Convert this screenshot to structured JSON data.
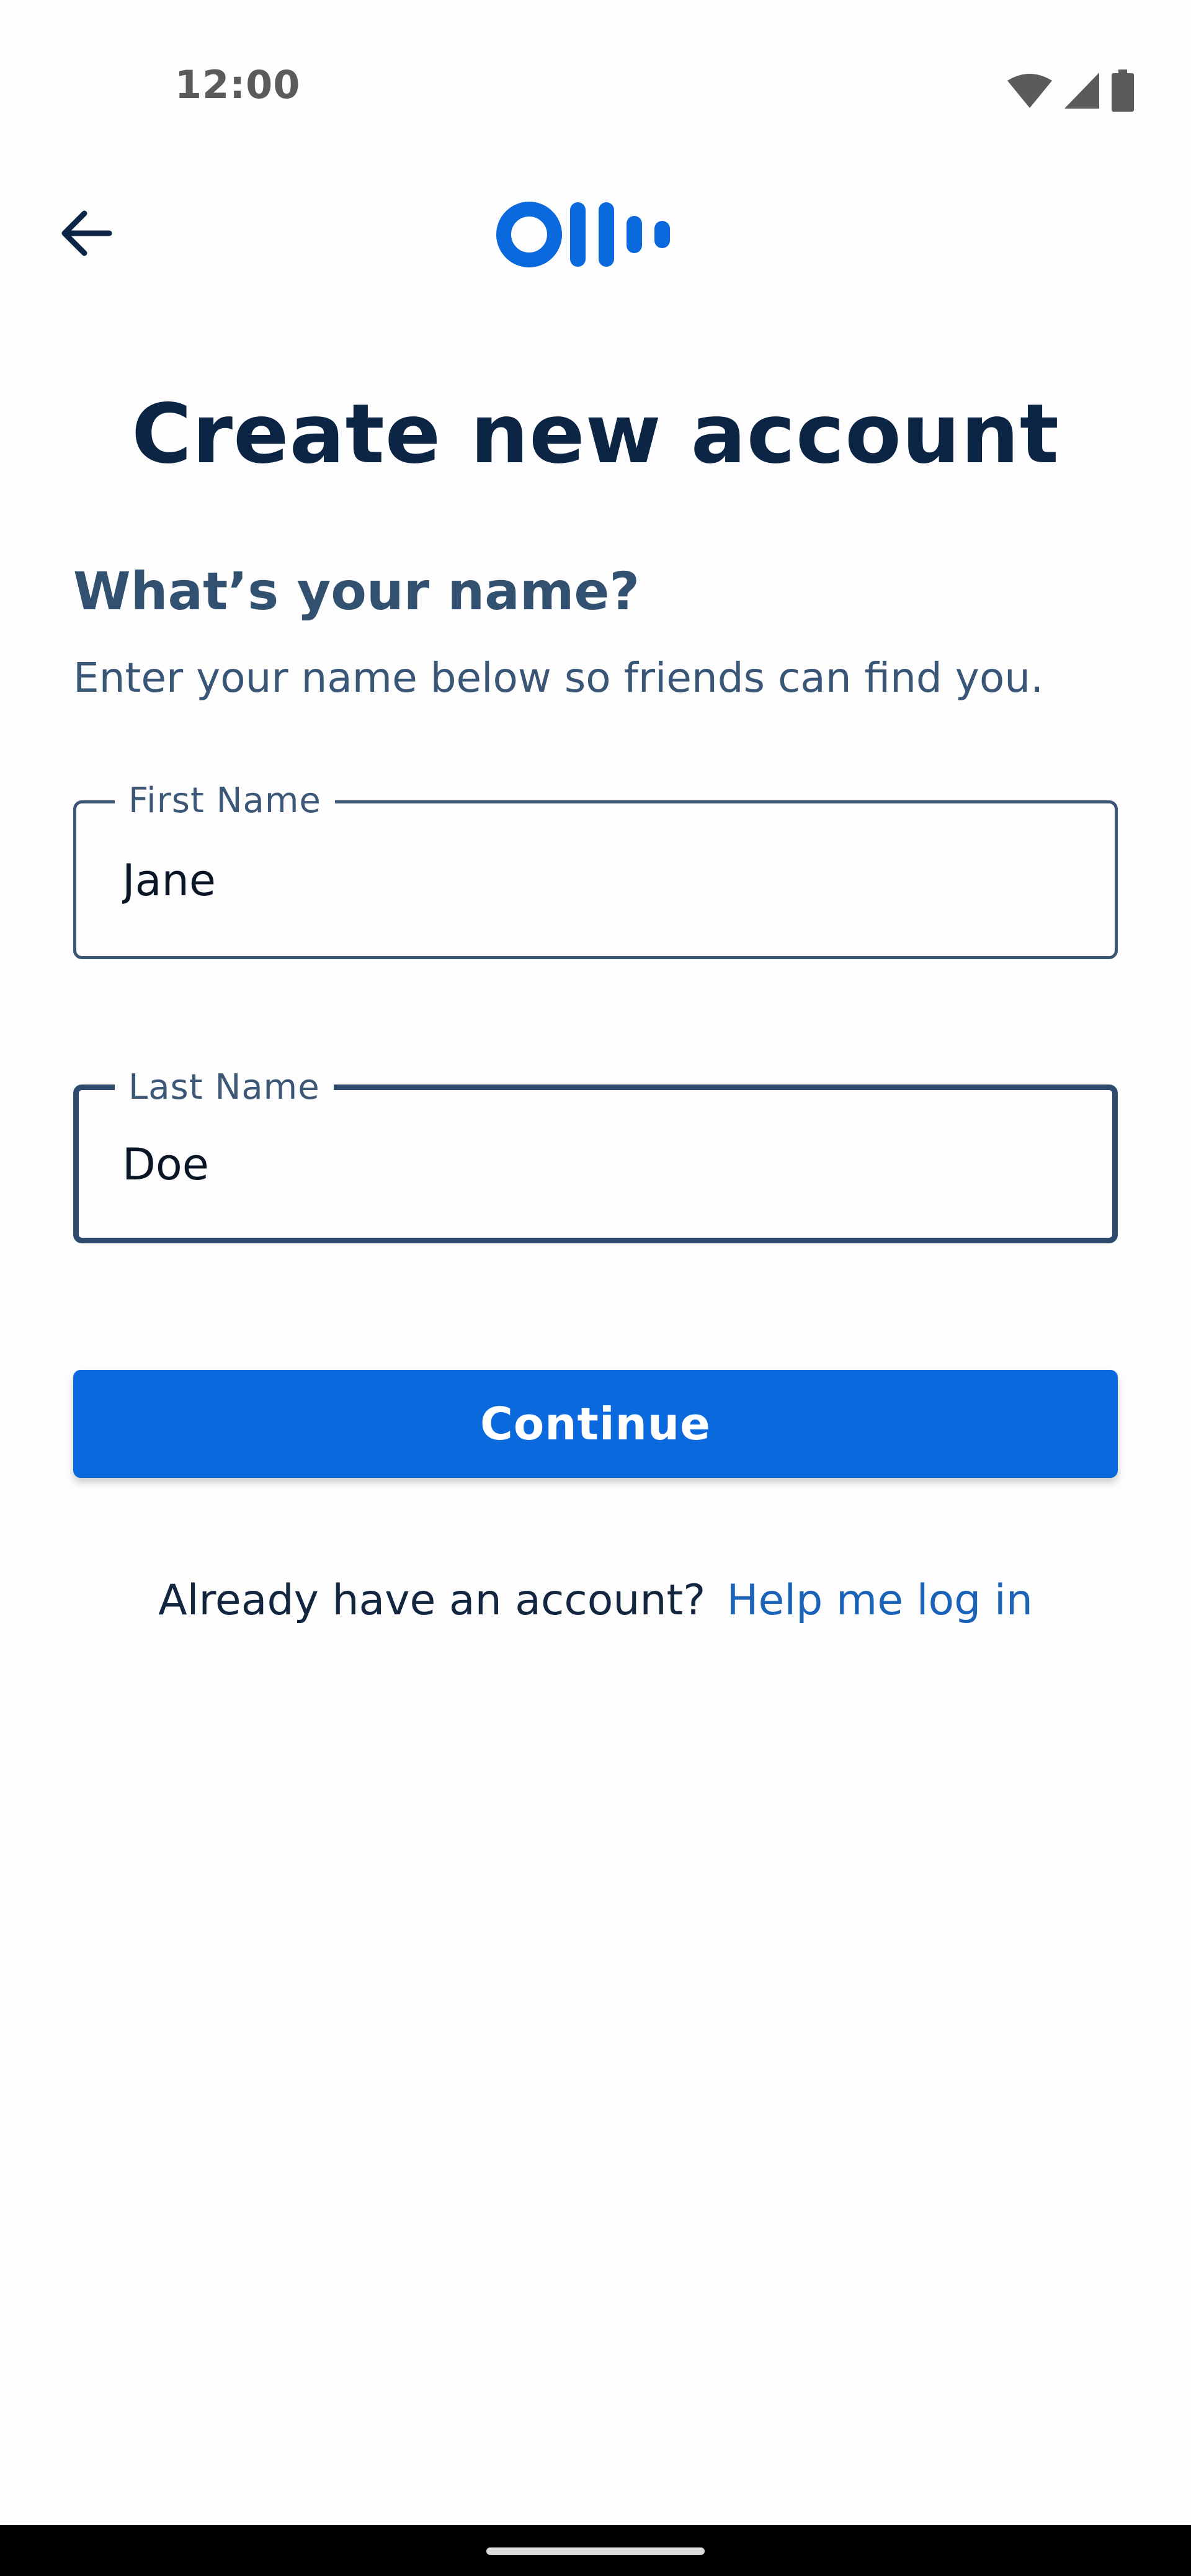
{
  "status_bar": {
    "time": "12:00",
    "icons": [
      "wifi-icon",
      "cellular-signal-icon",
      "battery-icon"
    ]
  },
  "app_bar": {
    "back_icon": "arrow-left-icon",
    "logo": "otter-logo"
  },
  "page": {
    "title": "Create new account",
    "heading": "What’s your name?",
    "subtitle": "Enter your name below so friends can find you."
  },
  "form": {
    "first_name": {
      "label": "First Name",
      "value": "Jane"
    },
    "last_name": {
      "label": "Last Name",
      "value": "Doe"
    },
    "continue_label": "Continue"
  },
  "login": {
    "prompt": "Already have an account?",
    "link": "Help me log in"
  },
  "colors": {
    "primary": "#0a69dc",
    "title": "#0c2545",
    "heading": "#32506f",
    "link": "#1b63b8",
    "field_border": "#3b5574",
    "status_icons": "#5b5b5b"
  }
}
